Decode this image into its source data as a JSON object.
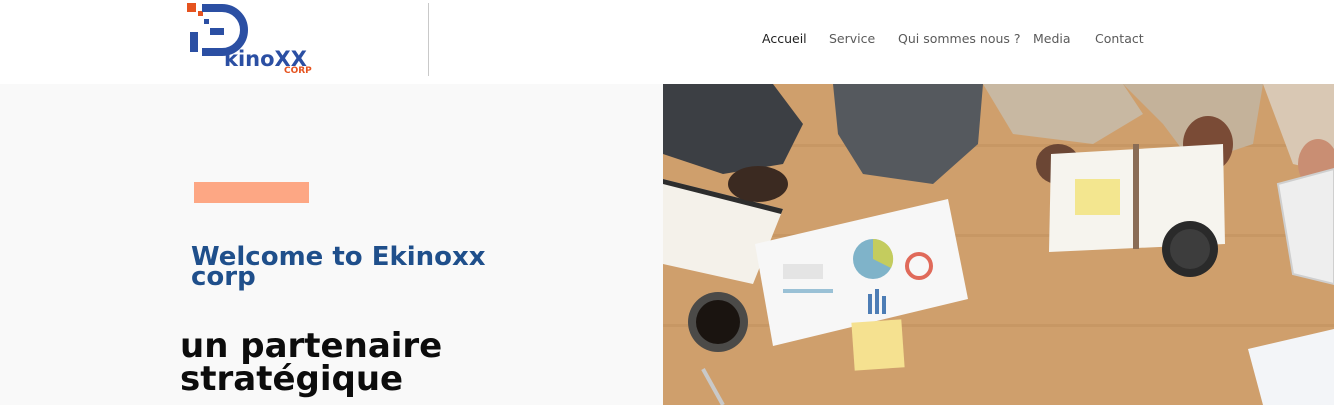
{
  "brand": {
    "logo_text": "kinoXX",
    "logo_sub": "CORP",
    "colors": {
      "primary": "#2b4fa3",
      "accent": "#e5531f"
    }
  },
  "nav": {
    "items": [
      {
        "label": "Accueil",
        "active": true
      },
      {
        "label": "Service",
        "active": false
      },
      {
        "label": "Qui sommes nous ?",
        "active": false
      },
      {
        "label": "Media",
        "active": false
      },
      {
        "label": "Contact",
        "active": false
      }
    ]
  },
  "hero": {
    "welcome": "Welcome to Ekinoxx corp",
    "tagline": "un partenaire stratégique",
    "accent_color": "#fda784",
    "image": "photo-of-team-meeting-with-reports-and-coffee"
  }
}
